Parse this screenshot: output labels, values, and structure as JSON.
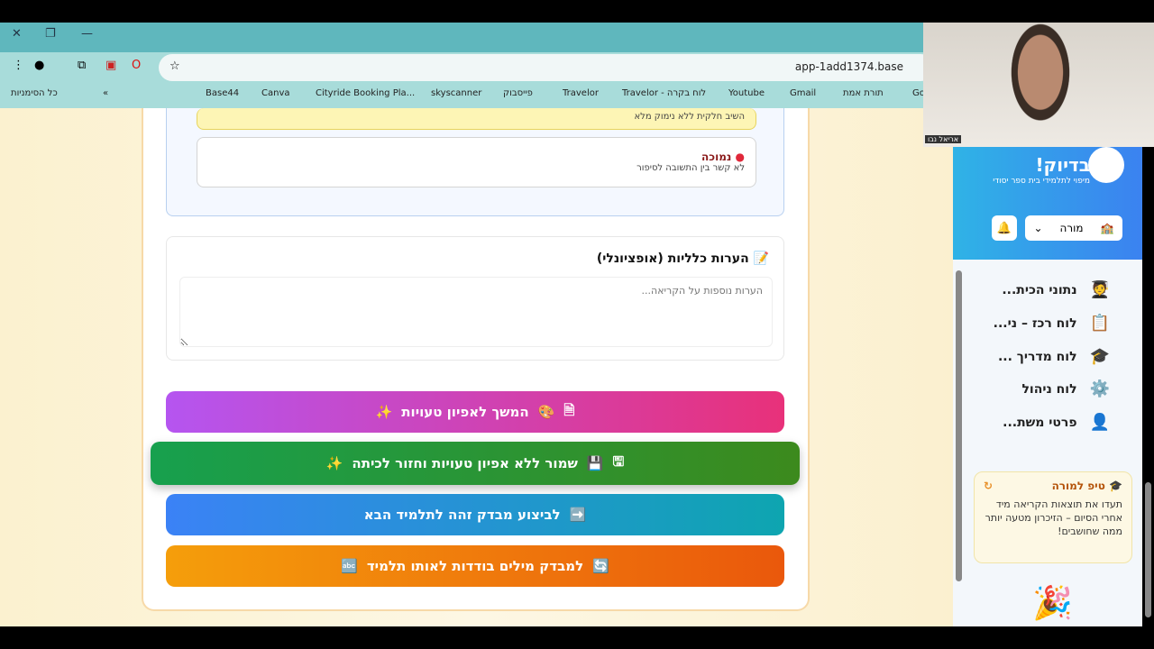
{
  "browser": {
    "url": "app-1add1374.base",
    "bookmarks": [
      "כל הסימניות",
      "Base44",
      "Canva",
      "Cityride Booking Pla...",
      "skyscanner",
      "פייסבוק",
      "Travelor",
      "Travelor - לוח בקרה",
      "Youtube",
      "Gmail",
      "תורת אמת",
      "Go"
    ]
  },
  "rubric": {
    "partial_desc": "השיב חלקית ללא נימוק מלא",
    "low_title": "נמוכה",
    "low_desc": "לא קשר בין התשובה לסיפור"
  },
  "notes": {
    "title": "הערות כלליות (אופציונלי)",
    "placeholder": "הערות נוספות על הקריאה..."
  },
  "buttons": {
    "continue": "המשך לאפיון טעויות",
    "save": "שמור ללא אפיון טעויות וחזור לכיתה",
    "same_test": "לביצוע מבדק זהה לתלמיד הבא",
    "words_test": "למבדק מילים בודדות לאותו תלמיד"
  },
  "webcam": {
    "name": "אריאל נבו"
  },
  "sidebar": {
    "brand": "בדיוק!",
    "subtitle": "מיפוי לתלמידי בית ספר יסודי",
    "role": "מורה",
    "nav": [
      {
        "label": "נתוני הכית...",
        "icon": "🧑‍🎓"
      },
      {
        "label": "לוח רכז – ני...",
        "icon": "📋"
      },
      {
        "label": "לוח מדריך ...",
        "icon": "🎓"
      },
      {
        "label": "לוח ניהול",
        "icon": "⚙️"
      },
      {
        "label": "פרטי משת...",
        "icon": "👤"
      }
    ],
    "tip_title": "טיפ למורה",
    "tip_body": "תעדו את תוצאות הקריאה מיד אחרי הסיום – הזיכרון מטעה יותר ממה שחושבים!"
  }
}
